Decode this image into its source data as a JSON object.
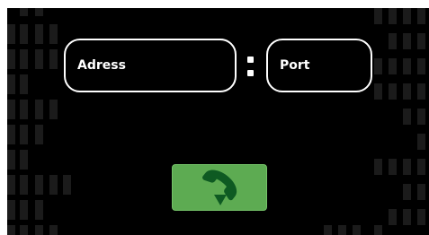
{
  "connect_form": {
    "address_placeholder": "Adress",
    "separator": ":",
    "port_placeholder": "Port"
  },
  "call_button": {
    "icon": "phone-hangup-icon",
    "color": "#5dab52"
  },
  "colors": {
    "background": "#000000",
    "pattern": "#1b1b1b",
    "field_border": "#ffffff",
    "text": "#ffffff",
    "icon": "#0e5a22"
  }
}
